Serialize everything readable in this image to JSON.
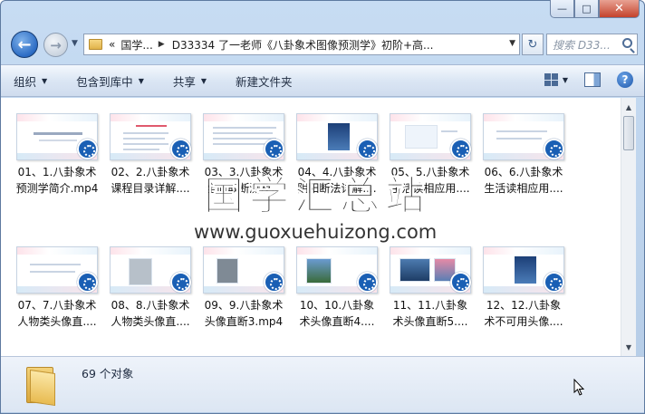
{
  "window": {
    "minimize": "—",
    "maximize": "□",
    "close": "✕"
  },
  "nav": {
    "back": "←",
    "forward": "→",
    "history_caret": "▼"
  },
  "address": {
    "overflow": "«",
    "crumb1": "国学...",
    "crumb2": "D33334 了一老师《八卦象术图像预测学》初阶+高...",
    "drop": "▼",
    "refresh": "↻",
    "search_placeholder": "搜索 D33..."
  },
  "toolbar": {
    "organize": "组织",
    "include": "包含到库中",
    "share": "共享",
    "new_folder": "新建文件夹",
    "caret": "▼",
    "help": "?"
  },
  "files": [
    {
      "line1": "01、1.八卦象术",
      "line2": "预测学简介.mp4"
    },
    {
      "line1": "02、2.八卦象术",
      "line2": "课程目录详解...."
    },
    {
      "line1": "03、3.八卦象术",
      "line2": "全面取断测及..."
    },
    {
      "line1": "04、4.八卦象术",
      "line2": "阴阳断法详解...."
    },
    {
      "line1": "05、5.八卦象术",
      "line2": "生活读相应用...."
    },
    {
      "line1": "06、6.八卦象术",
      "line2": "生活读相应用...."
    },
    {
      "line1": "07、7.八卦象术",
      "line2": "人物类头像直...."
    },
    {
      "line1": "08、8.八卦象术",
      "line2": "人物类头像直...."
    },
    {
      "line1": "09、9.八卦象术",
      "line2": "头像直断3.mp4"
    },
    {
      "line1": "10、10.八卦象",
      "line2": "术头像直断4...."
    },
    {
      "line1": "11、11.八卦象",
      "line2": "术头像直断5...."
    },
    {
      "line1": "12、12.八卦象",
      "line2": "术不可用头像...."
    }
  ],
  "watermark": {
    "main": "国学汇总站",
    "url": "www.guoxuehuizong.com"
  },
  "status": {
    "count": "69 个对象"
  }
}
